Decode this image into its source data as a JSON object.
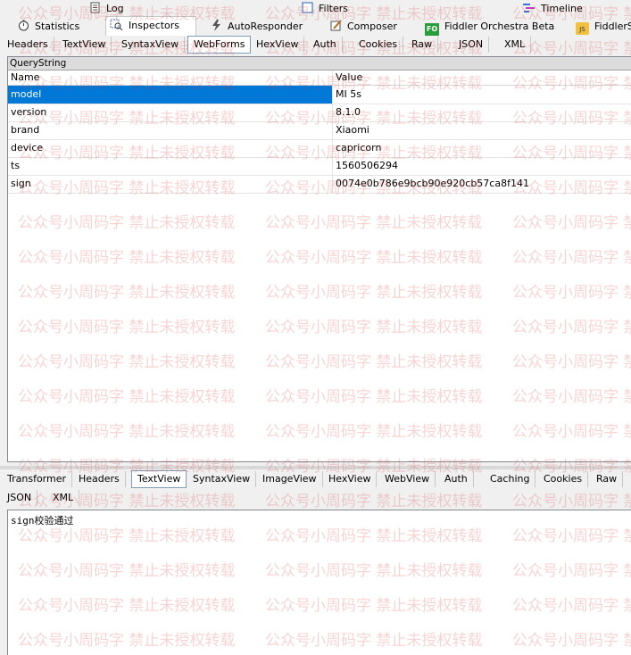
{
  "top_tabs_row1": [
    {
      "label": "Log",
      "icon": "log-icon"
    },
    {
      "label": "Filters",
      "icon": "checkbox-icon"
    },
    {
      "label": "Timeline",
      "icon": "timeline-icon"
    }
  ],
  "top_tabs_row2": [
    {
      "label": "Statistics",
      "icon": "stopwatch-icon"
    },
    {
      "label": "Inspectors",
      "icon": "inspect-icon"
    },
    {
      "label": "AutoResponder",
      "icon": "lightning-icon"
    },
    {
      "label": "Composer",
      "icon": "composer-icon"
    },
    {
      "label": "Fiddler Orchestra Beta",
      "icon": "fo-icon",
      "icon_text": "FO"
    },
    {
      "label": "FiddlerSc",
      "icon": "script-icon",
      "icon_text": "JS"
    }
  ],
  "request_tabs": [
    "Headers",
    "TextView",
    "SyntaxView",
    "WebForms",
    "HexView",
    "Auth",
    "Cookies",
    "Raw",
    "JSON",
    "XML"
  ],
  "request_selected": "WebForms",
  "querystring": {
    "title": "QueryString",
    "col_name": "Name",
    "col_value": "Value",
    "rows": [
      {
        "name": "model",
        "value": "MI 5s"
      },
      {
        "name": "version",
        "value": "8.1.0"
      },
      {
        "name": "brand",
        "value": "Xiaomi"
      },
      {
        "name": "device",
        "value": "capricorn"
      },
      {
        "name": "ts",
        "value": "1560506294"
      },
      {
        "name": "sign",
        "value": "0074e0b786e9bcb90e920cb57ca8f141"
      }
    ]
  },
  "response_tabs_row1": [
    "Transformer",
    "Headers",
    "TextView",
    "SyntaxView",
    "ImageView",
    "HexView",
    "WebView",
    "Auth",
    "Caching",
    "Cookies",
    "Raw"
  ],
  "response_tabs_row2": [
    "JSON",
    "XML"
  ],
  "response_selected": "TextView",
  "response_text": "sign校验通过",
  "watermark_text": "公众号小周码字  禁止未授权转载",
  "colors": {
    "selection": "#0078d7",
    "watermark": "#dc3c3c"
  }
}
